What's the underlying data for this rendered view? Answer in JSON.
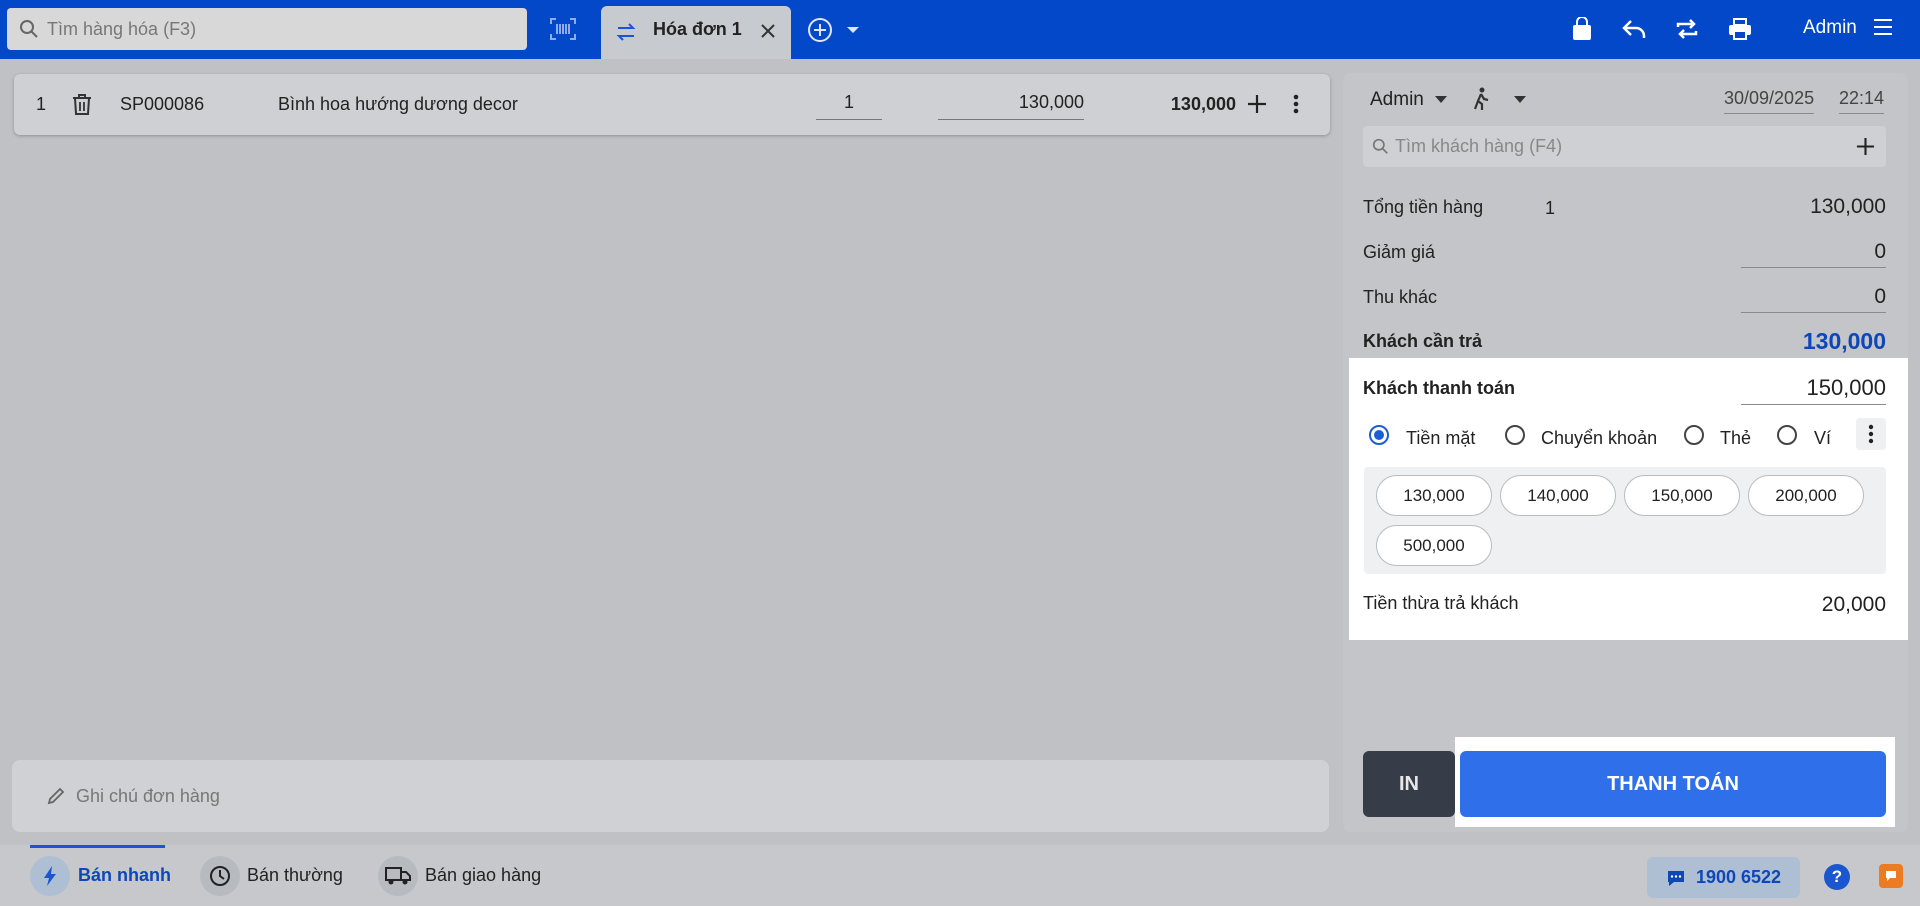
{
  "topbar": {
    "search_placeholder": "Tìm hàng hóa (F3)",
    "active_tab": "Hóa đơn 1",
    "user": "Admin"
  },
  "order_items": [
    {
      "index": "1",
      "code": "SP000086",
      "name": "Bình hoa hướng dương decor",
      "quantity": "1",
      "unit_price": "130,000",
      "line_total": "130,000"
    }
  ],
  "note_placeholder": "Ghi chú đơn hàng",
  "checkout": {
    "staff": "Admin",
    "date": "30/09/2025",
    "time": "22:14",
    "customer_search_placeholder": "Tìm khách hàng (F4)",
    "subtotal_label": "Tổng tiền hàng",
    "subtotal_count": "1",
    "subtotal_value": "130,000",
    "discount_label": "Giảm giá",
    "discount_value": "0",
    "other_fee_label": "Thu khác",
    "other_fee_value": "0",
    "amount_due_label": "Khách cần trả",
    "amount_due_value": "130,000",
    "paid_label": "Khách thanh toán",
    "paid_value": "150,000",
    "payment_methods": [
      "Tiền mặt",
      "Chuyển khoản",
      "Thẻ",
      "Ví"
    ],
    "selected_method": "Tiền mặt",
    "quick_amounts": [
      "130,000",
      "140,000",
      "150,000",
      "200,000",
      "500,000"
    ],
    "change_label": "Tiền thừa trả khách",
    "change_value": "20,000",
    "print_button": "IN",
    "pay_button": "THANH TOÁN"
  },
  "bottombar": {
    "modes": [
      "Bán nhanh",
      "Bán thường",
      "Bán giao hàng"
    ],
    "active_mode": "Bán nhanh",
    "hotline": "1900 6522"
  },
  "colors": {
    "topbar": "#0248c8",
    "accent": "#2f70ea",
    "amount_due": "#0d47b8"
  }
}
